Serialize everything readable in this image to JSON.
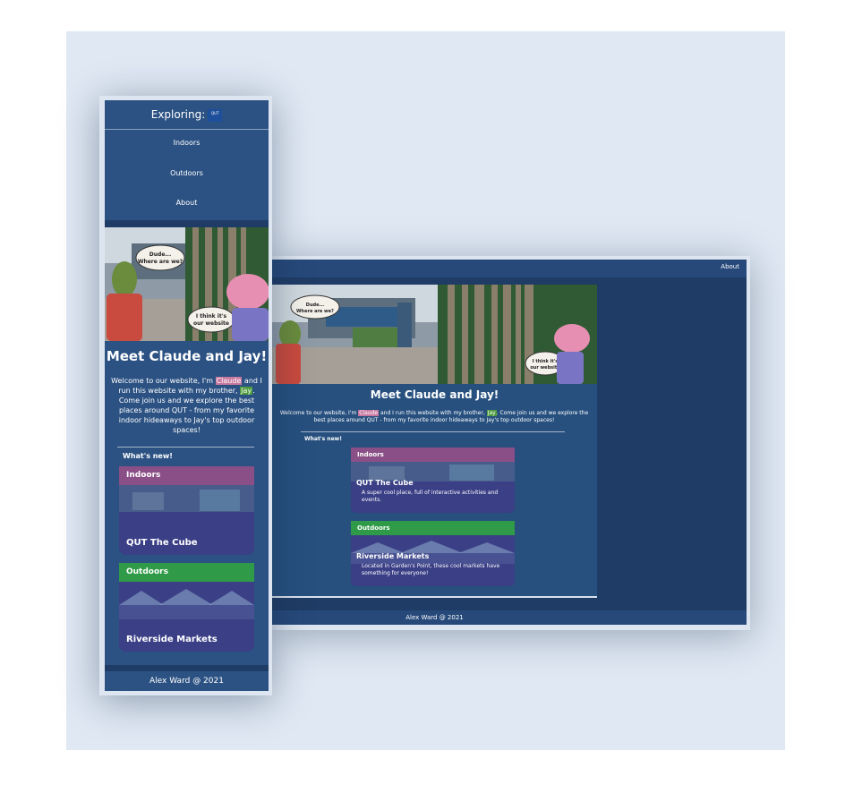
{
  "mobile": {
    "brand": "Exploring:",
    "logo_text": "QUT",
    "nav": [
      "Indoors",
      "Outdoors",
      "About"
    ],
    "hero": {
      "bubble1": [
        "Dude...",
        "Where are we?"
      ],
      "bubble2": [
        "I think it's",
        "our website"
      ]
    },
    "title": "Meet Claude and Jay!",
    "intro": {
      "part1": "Welcome to our website, I'm ",
      "name1": "Claude",
      "part2": " and I run this website with my brother, ",
      "name2": "Jay",
      "part3": ". Come join us and we explore the best places around QUT - from my favorite indoor hideaways to Jay's top outdoor spaces!"
    },
    "whats_new": "What's new!",
    "cards": [
      {
        "tag": "Indoors",
        "name": "QUT The Cube"
      },
      {
        "tag": "Outdoors",
        "name": "Riverside Markets"
      }
    ],
    "footer": "Alex Ward @ 2021"
  },
  "desktop": {
    "nav_about": "About",
    "hero": {
      "bubble1": [
        "Dude...",
        "Where are we?"
      ],
      "bubble2": [
        "I think it's",
        "our website"
      ]
    },
    "title": "Meet Claude and Jay!",
    "intro": {
      "part1": "Welcome to our website, I'm ",
      "name1": "Claude",
      "part2": " and I run this website with my brother, ",
      "name2": "Jay",
      "part3": ". Come join us and we explore the best places around QUT - from my favorite indoor hideaways to Jay's top outdoor spaces!"
    },
    "whats_new": "What's new!",
    "cards": [
      {
        "tag": "Indoors",
        "name": "QUT The Cube",
        "desc": "A super cool place, full of interactive activities and events."
      },
      {
        "tag": "Outdoors",
        "name": "Riverside Markets",
        "desc": "Located in Garden's Point, these cool markets have something for everyone!"
      }
    ],
    "footer": "Alex Ward @ 2021"
  },
  "colors": {
    "page_bg": "#dfe8f3",
    "site_bg": "#27507f",
    "indoors_tag": "#8a4f86",
    "outdoors_tag": "#2f9a47",
    "claude_highlight": "#c8789f",
    "jay_highlight": "#4c9a3c"
  }
}
